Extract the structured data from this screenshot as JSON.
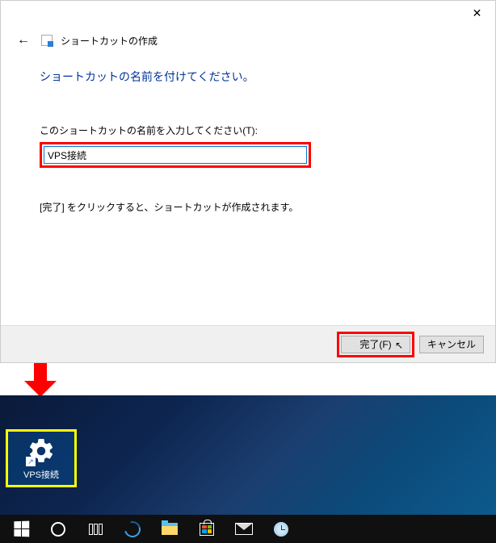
{
  "dialog": {
    "window_title": "ショートカットの作成",
    "heading": "ショートカットの名前を付けてください。",
    "input_label": "このショートカットの名前を入力してください(T):",
    "input_value": "VPS接続",
    "info_text": "[完了] をクリックすると、ショートカットが作成されます。",
    "buttons": {
      "finish": "完了(F)",
      "cancel": "キャンセル"
    }
  },
  "desktop": {
    "shortcut_label": "VPS接続"
  },
  "taskbar": {
    "items": [
      "start",
      "cortana",
      "task-view",
      "edge",
      "file-explorer",
      "store",
      "mail",
      "clock"
    ]
  },
  "highlights": {
    "input": "#ff0000",
    "finish_button": "#ff0000",
    "shortcut": "#ffff00"
  }
}
